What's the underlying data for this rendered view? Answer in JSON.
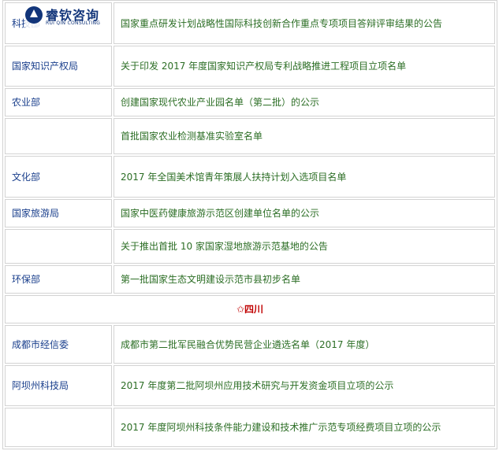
{
  "logo": {
    "cn_text": "睿钦咨询",
    "en_text": "RUI QIN CONSULTING"
  },
  "rows": [
    {
      "dept": "科技部",
      "item": "国家重点研发计划战略性国际科技创新合作重点专项项目答辩评审结果的公告"
    },
    {
      "dept": "国家知识产权局",
      "item": "关于印发 2017 年度国家知识产权局专利战略推进工程项目立项名单"
    },
    {
      "dept": "农业部",
      "item": "创建国家现代农业产业园名单（第二批）的公示"
    },
    {
      "dept": "",
      "item": "首批国家农业检测基准实验室名单"
    },
    {
      "dept": "文化部",
      "item": "2017 年全国美术馆青年策展人扶持计划入选项目名单"
    },
    {
      "dept": "国家旅游局",
      "item": "国家中医药健康旅游示范区创建单位名单的公示"
    },
    {
      "dept": "",
      "item": "关于推出首批 10 家国家湿地旅游示范基地的公告"
    },
    {
      "dept": "环保部",
      "item": "第一批国家生态文明建设示范市县初步名单"
    }
  ],
  "section": {
    "star": "✩",
    "title": "四川"
  },
  "rows2": [
    {
      "dept": "成都市经信委",
      "item": "成都市第二批军民融合优势民营企业遴选名单（2017 年度）"
    },
    {
      "dept": "阿坝州科技局",
      "item": "2017 年度第二批阿坝州应用技术研究与开发资金项目立项的公示"
    },
    {
      "dept": "",
      "item": "2017 年度阿坝州科技条件能力建设和技术推广示范专项经费项目立项的公示"
    }
  ]
}
